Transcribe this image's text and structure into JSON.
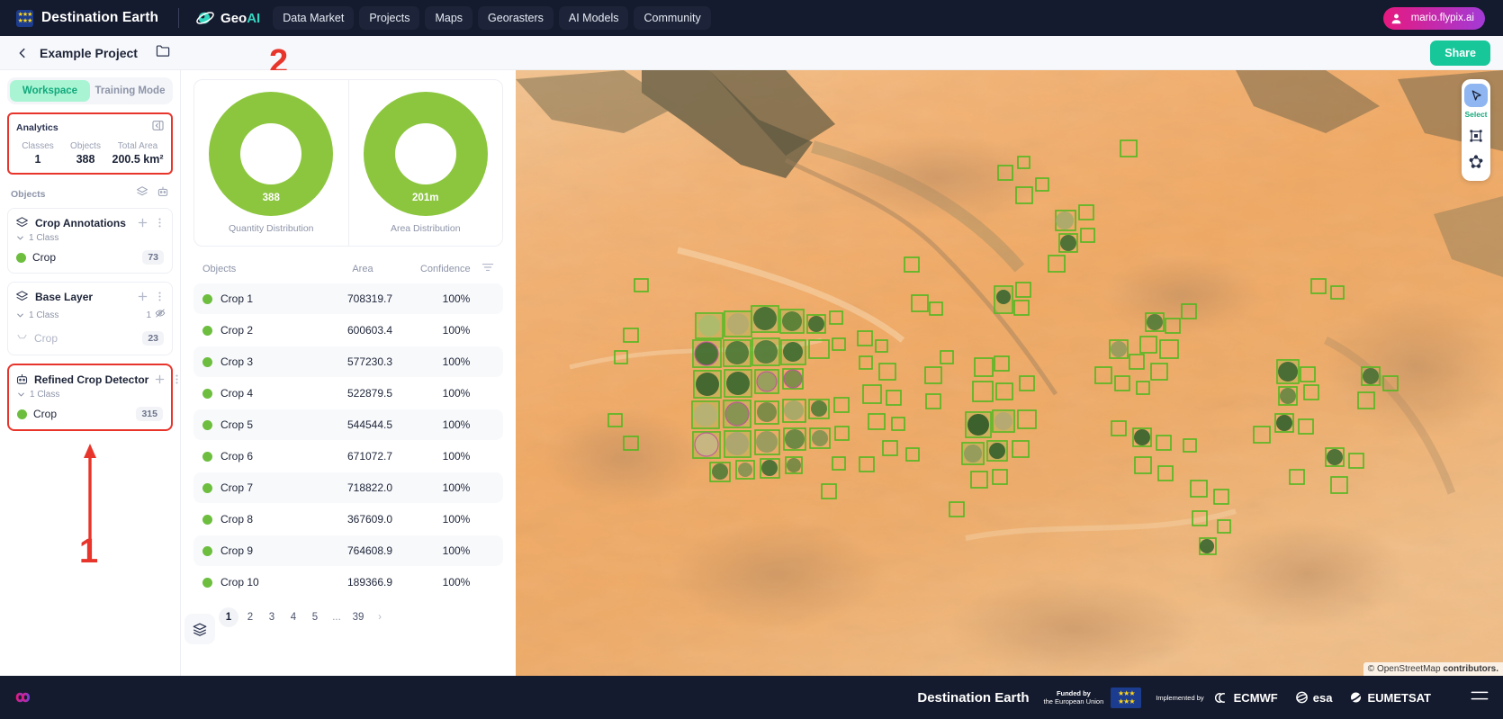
{
  "topnav": {
    "brand": "Destination Earth",
    "product": "Geo",
    "product_accent": "AI",
    "items": [
      {
        "label": "Data Market"
      },
      {
        "label": "Projects"
      },
      {
        "label": "Maps"
      },
      {
        "label": "Georasters"
      },
      {
        "label": "AI Models"
      },
      {
        "label": "Community"
      }
    ],
    "user": "mario.flypix.ai"
  },
  "projectbar": {
    "title": "Example Project",
    "share_label": "Share"
  },
  "sidebar": {
    "tabs": [
      {
        "label": "Workspace",
        "active": true
      },
      {
        "label": "Training Mode",
        "active": false
      }
    ],
    "analytics": {
      "title": "Analytics",
      "stats": [
        {
          "label": "Classes",
          "value": "1"
        },
        {
          "label": "Objects",
          "value": "388"
        },
        {
          "label": "Total Area",
          "value": "200.5 km²"
        }
      ]
    },
    "objects_title": "Objects",
    "layers": [
      {
        "name": "Crop Annotations",
        "icon": "layers-icon",
        "class_count": "1 Class",
        "hidden_count": "",
        "highlighted": false,
        "classes": [
          {
            "name": "Crop",
            "count": "73",
            "color": "#6dbe3f",
            "muted": false
          }
        ]
      },
      {
        "name": "Base Layer",
        "icon": "layers-icon",
        "class_count": "1 Class",
        "hidden_count": "1",
        "highlighted": false,
        "classes": [
          {
            "name": "Crop",
            "count": "23",
            "color": "#d6dae4",
            "muted": true
          }
        ]
      },
      {
        "name": "Refined Crop Detector",
        "icon": "robot-icon",
        "class_count": "1 Class",
        "hidden_count": "",
        "highlighted": true,
        "classes": [
          {
            "name": "Crop",
            "count": "315",
            "color": "#6dbe3f",
            "muted": false
          }
        ]
      }
    ]
  },
  "annotations": [
    {
      "id": "1",
      "label": "1"
    },
    {
      "id": "2",
      "label": "2"
    }
  ],
  "chart_data": [
    {
      "type": "pie",
      "title": "Quantity Distribution",
      "categories": [
        "Crop"
      ],
      "values": [
        388
      ],
      "center_label": "388",
      "colors": [
        "#8cc63f"
      ],
      "legend": "none"
    },
    {
      "type": "pie",
      "title": "Area Distribution",
      "categories": [
        "Crop"
      ],
      "values": [
        201
      ],
      "center_label": "201m",
      "colors": [
        "#8cc63f"
      ],
      "legend": "none"
    }
  ],
  "table": {
    "columns": [
      "Objects",
      "Area",
      "Confidence"
    ],
    "rows": [
      {
        "name": "Crop 1",
        "area": "708319.7",
        "confidence": "100%",
        "color": "#6dbe3f"
      },
      {
        "name": "Crop 2",
        "area": "600603.4",
        "confidence": "100%",
        "color": "#6dbe3f"
      },
      {
        "name": "Crop 3",
        "area": "577230.3",
        "confidence": "100%",
        "color": "#6dbe3f"
      },
      {
        "name": "Crop 4",
        "area": "522879.5",
        "confidence": "100%",
        "color": "#6dbe3f"
      },
      {
        "name": "Crop 5",
        "area": "544544.5",
        "confidence": "100%",
        "color": "#6dbe3f"
      },
      {
        "name": "Crop 6",
        "area": "671072.7",
        "confidence": "100%",
        "color": "#6dbe3f"
      },
      {
        "name": "Crop 7",
        "area": "718822.0",
        "confidence": "100%",
        "color": "#6dbe3f"
      },
      {
        "name": "Crop 8",
        "area": "367609.0",
        "confidence": "100%",
        "color": "#6dbe3f"
      },
      {
        "name": "Crop 9",
        "area": "764608.9",
        "confidence": "100%",
        "color": "#6dbe3f"
      },
      {
        "name": "Crop 10",
        "area": "189366.9",
        "confidence": "100%",
        "color": "#6dbe3f"
      }
    ],
    "pagination": {
      "prev": "‹",
      "pages": [
        "1",
        "2",
        "3",
        "4",
        "5",
        "...",
        "39"
      ],
      "current": "1",
      "next": "›"
    }
  },
  "map": {
    "tools": [
      {
        "name": "select",
        "label": "Select",
        "active": true
      },
      {
        "name": "bbox",
        "label": "",
        "active": false
      },
      {
        "name": "polygon",
        "label": "",
        "active": false
      }
    ],
    "attribution_prefix": "© OpenStreetMap ",
    "attribution_link": "contributors."
  },
  "footer": {
    "brand": "Destination Earth",
    "funded_line1": "Funded by",
    "funded_line2": "the European Union",
    "implemented_by": "Implemented by",
    "orgs": [
      "ECMWF",
      "esa",
      "EUMETSAT"
    ]
  }
}
